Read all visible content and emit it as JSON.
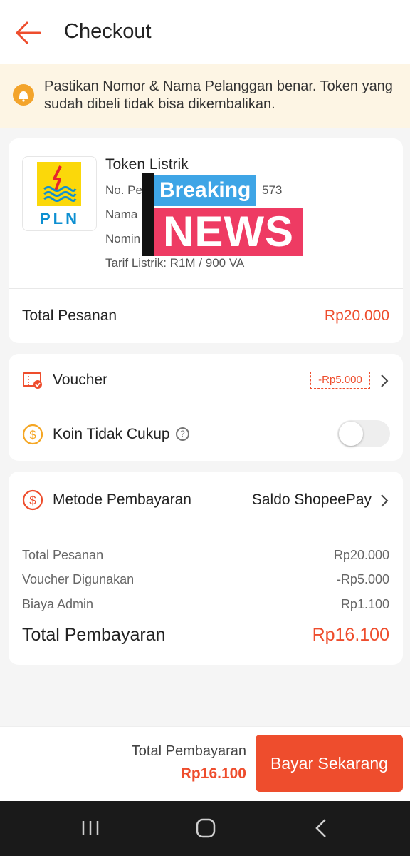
{
  "header": {
    "title": "Checkout",
    "back_icon": "arrow-left-icon"
  },
  "notice": {
    "text": "Pastikan Nomor & Nama Pelanggan benar. Token yang sudah dibeli tidak bisa dikembalikan.",
    "icon": "bell-icon"
  },
  "product": {
    "logo_text": "PLN",
    "name": "Token Listrik",
    "line1": "No. Pe",
    "line1_tail": "573",
    "line2": "Nama",
    "line3": "Nomin",
    "line4": "Tarif Listrik: R1M / 900 VA"
  },
  "overlay": {
    "top": "Breaking",
    "bottom": "NEWS"
  },
  "order": {
    "label": "Total Pesanan",
    "value": "Rp20.000"
  },
  "voucher": {
    "label": "Voucher",
    "value": "-Rp5.000",
    "icon": "ticket-icon"
  },
  "coin": {
    "label": "Koin Tidak Cukup",
    "help": "?",
    "icon": "coin-icon"
  },
  "payment": {
    "label": "Metode Pembayaran",
    "value": "Saldo ShopeePay",
    "icon": "dollar-circle-icon"
  },
  "summary": {
    "rows": [
      {
        "label": "Total Pesanan",
        "value": "Rp20.000"
      },
      {
        "label": "Voucher Digunakan",
        "value": "-Rp5.000"
      },
      {
        "label": "Biaya Admin",
        "value": "Rp1.100"
      }
    ],
    "total_label": "Total Pembayaran",
    "total_value": "Rp16.100"
  },
  "bottom_bar": {
    "label": "Total Pembayaran",
    "value": "Rp16.100",
    "button": "Bayar Sekarang"
  },
  "colors": {
    "accent": "#ee4d2d",
    "notice_bg": "#fdf5e4",
    "pln_yellow": "#fbd80a",
    "pln_blue": "#0d8fd1"
  }
}
